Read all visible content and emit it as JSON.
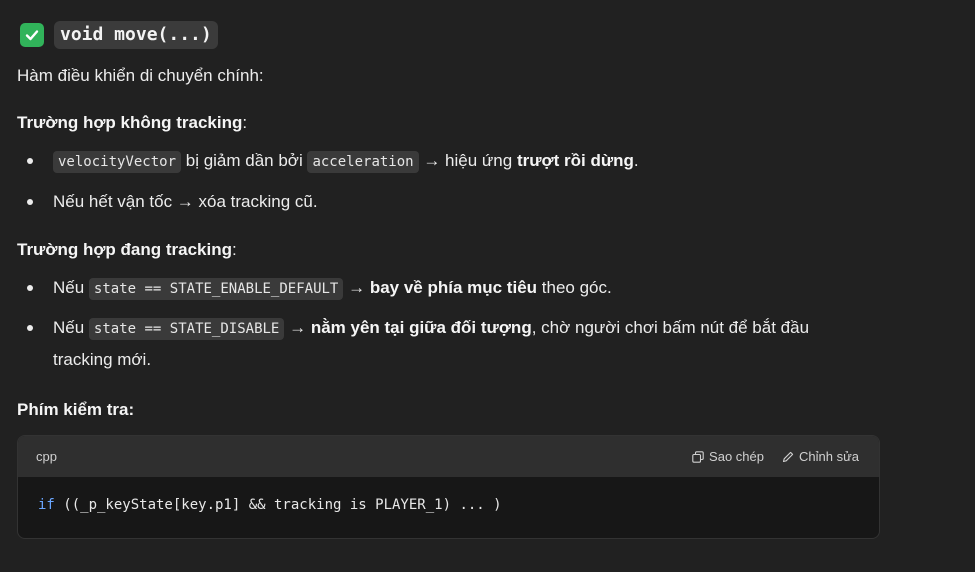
{
  "heading": {
    "code": "void move(...)",
    "check_color": "#31b35a"
  },
  "intro": "Hàm điều khiển di chuyển chính:",
  "section1": {
    "title_prefix": "Trường hợp ",
    "title_bold": "không tracking",
    "title_suffix": ":",
    "bullets": [
      {
        "code1": "velocityVector",
        "t1": " bị giảm dần bởi ",
        "code2": "acceleration",
        "t2": " → hiệu ứng ",
        "bold": "trượt rồi dừng",
        "t3": "."
      },
      {
        "text": "Nếu hết vận tốc → xóa tracking cũ."
      }
    ]
  },
  "section2": {
    "title_prefix": "Trường hợp ",
    "title_bold": "đang tracking",
    "title_suffix": ":",
    "bullets": [
      {
        "t1": "Nếu ",
        "code": "state == STATE_ENABLE_DEFAULT",
        "t2": " → ",
        "bold": "bay về phía mục tiêu",
        "t3": " theo góc."
      },
      {
        "t1": "Nếu ",
        "code": "state == STATE_DISABLE",
        "t2": " → ",
        "bold": "nằm yên tại giữa đối tượng",
        "t3": ", chờ người chơi bấm nút để bắt đầu",
        "t4": "tracking mới."
      }
    ]
  },
  "keys_title": "Phím kiểm tra:",
  "code_block": {
    "language": "cpp",
    "copy_label": "Sao chép",
    "edit_label": "Chỉnh sửa",
    "keyword": "if",
    "code_rest": " ((_p_keyState[key.p1] && tracking is PLAYER_1) ... )",
    "keyword_color": "#6aa6ff"
  }
}
